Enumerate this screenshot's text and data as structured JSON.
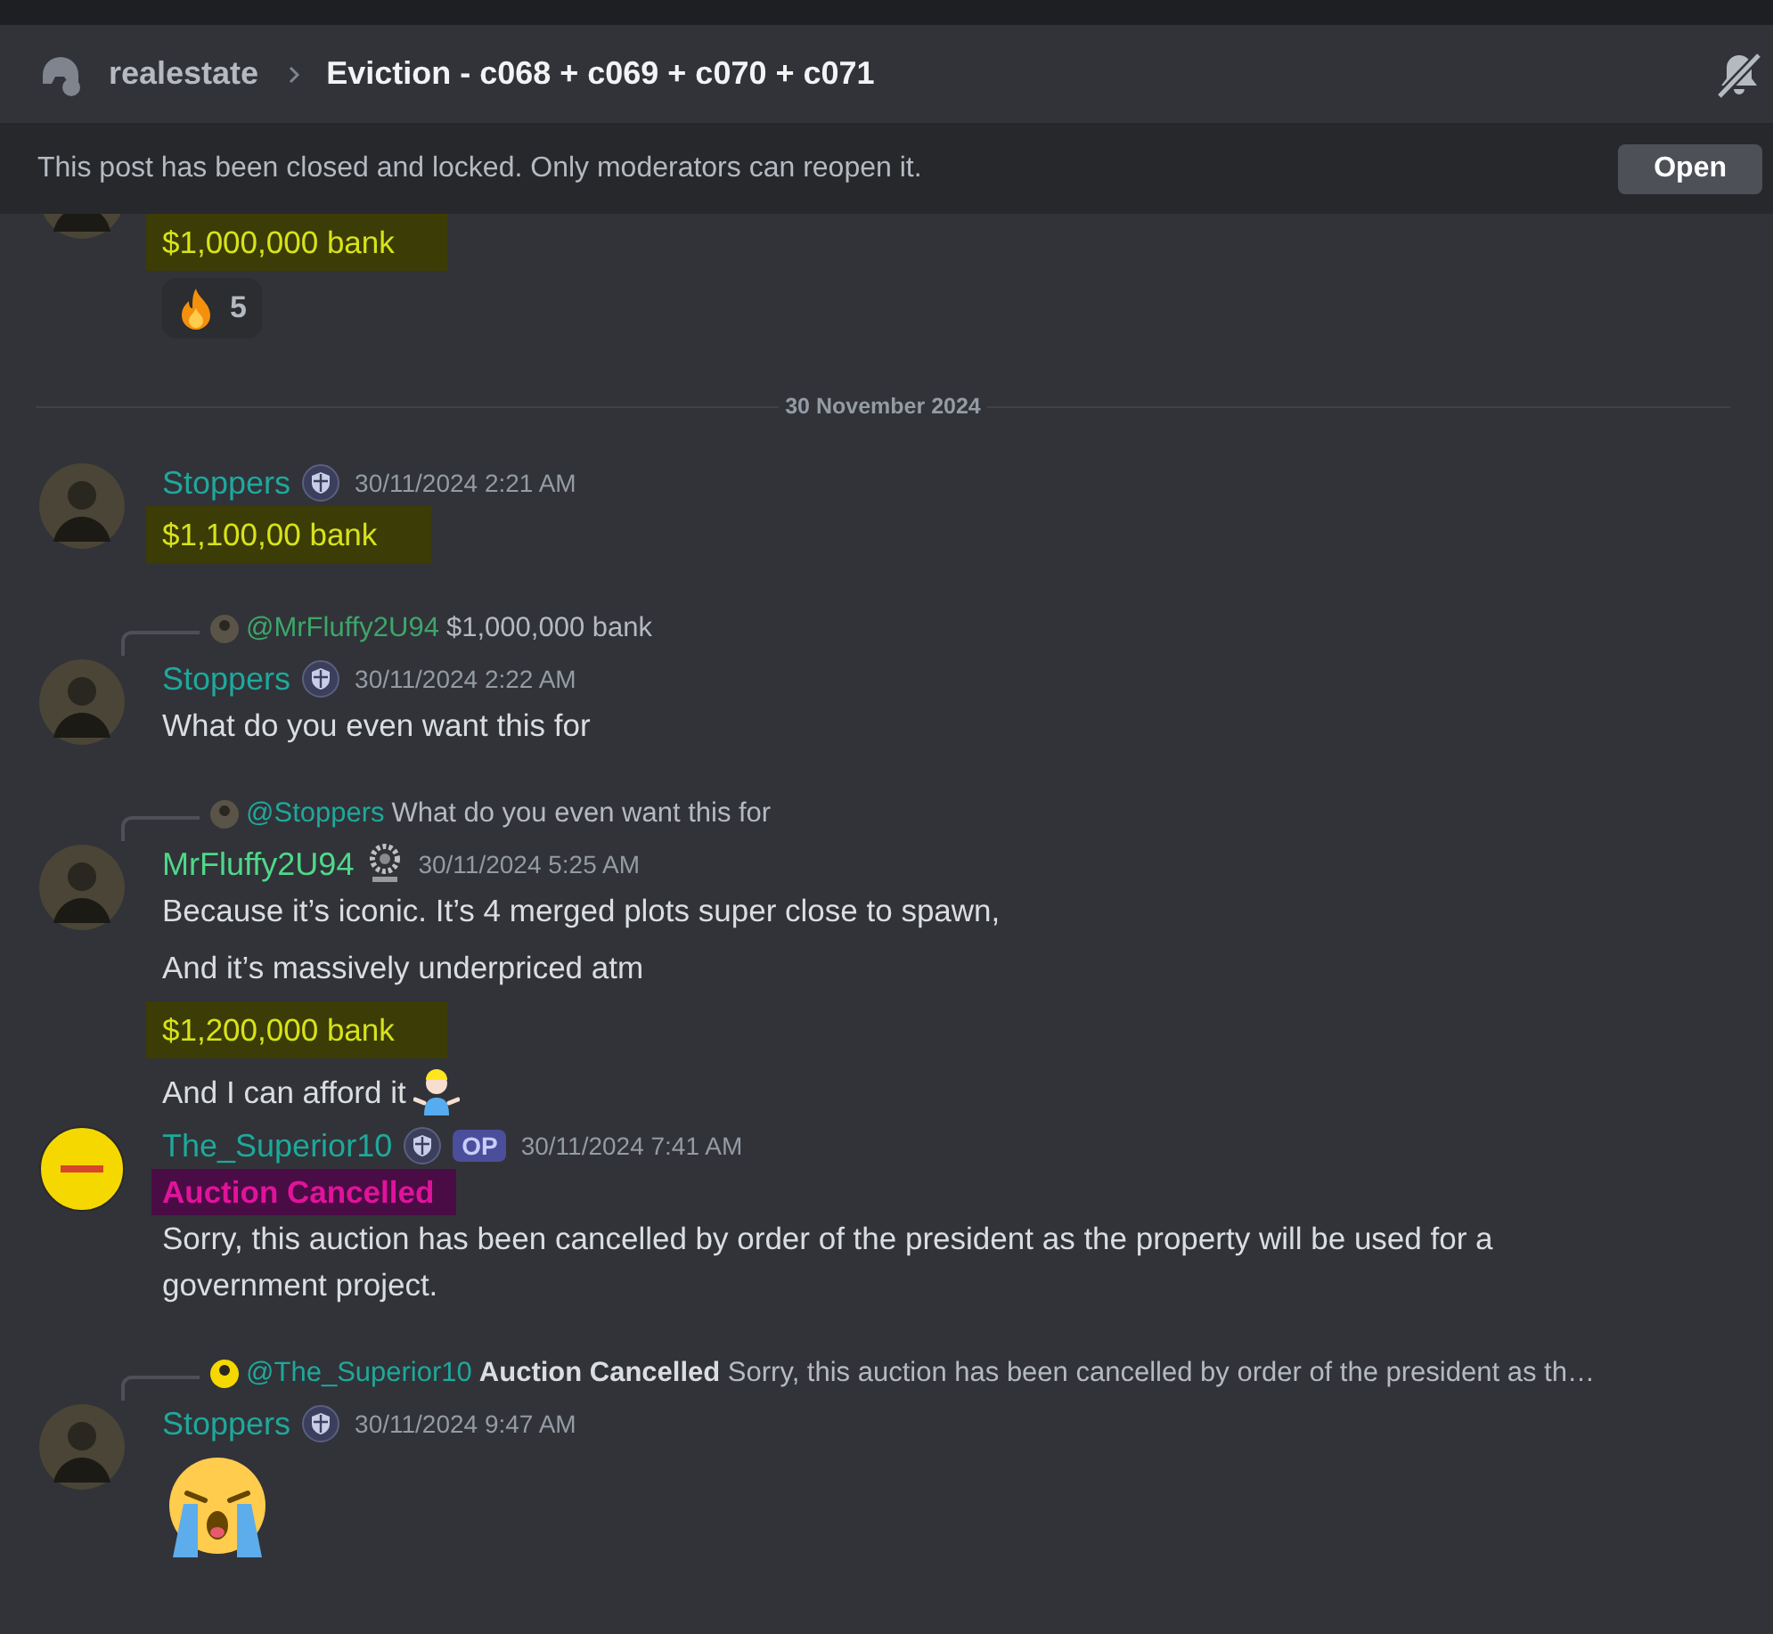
{
  "header": {
    "channel": "realestate",
    "thread": "Eviction - c068 + c069 + c070 + c071"
  },
  "banner": {
    "text": "This post has been closed and locked. Only moderators can reopen it.",
    "button": "Open"
  },
  "top_message": {
    "lines": [
      {
        "kind": "highlight",
        "text": "$1,000,000 bank"
      }
    ],
    "reactions": [
      {
        "kind": "fire",
        "count": "5"
      }
    ]
  },
  "divider": "30 November 2024",
  "messages": [
    {
      "author": "Stoppers",
      "color": "#1fa89c",
      "badge": {
        "kind": "shield"
      },
      "op": false,
      "timestamp": "30/11/2024 2:21 AM",
      "lines": [
        {
          "kind": "highlight",
          "text": "$1,100,00 bank"
        }
      ]
    },
    {
      "reply": {
        "mention": "@MrFluffy2U94",
        "color": "#3ea66b",
        "text": "$1,000,000 bank"
      },
      "author": "Stoppers",
      "color": "#1fa89c",
      "badge": {
        "kind": "shield"
      },
      "op": false,
      "timestamp": "30/11/2024 2:22 AM",
      "lines": [
        {
          "kind": "text",
          "text": "What do you even want this for"
        }
      ]
    },
    {
      "reply": {
        "mention": "@Stoppers",
        "color": "#1fa89c",
        "text": "What do you even want this for"
      },
      "author": "MrFluffy2U94",
      "color": "#4fd88a",
      "badge": {
        "kind": "wreath"
      },
      "op": false,
      "timestamp": "30/11/2024 5:25 AM",
      "lines": [
        {
          "kind": "text",
          "text": "Because it’s iconic. It’s 4 merged plots super close to spawn,"
        },
        {
          "kind": "text",
          "text": "And it’s massively underpriced atm"
        },
        {
          "kind": "highlight",
          "text": "$1,200,000 bank"
        },
        {
          "kind": "text",
          "text": "And I can afford it",
          "trailing_emoji": {
            "kind": "shrug"
          }
        }
      ]
    },
    {
      "author": "The_Superior10",
      "color": "#1fa89c",
      "badge": {
        "kind": "shield"
      },
      "op": true,
      "op_label": "OP",
      "timestamp": "30/11/2024 7:41 AM",
      "lines": [
        {
          "kind": "heading",
          "text": "Auction Cancelled"
        },
        {
          "kind": "text",
          "text": "Sorry, this auction has been cancelled by order of the president as the property will be used for a government project."
        }
      ]
    },
    {
      "reply": {
        "mention": "@The_Superior10",
        "color": "#1fa89c",
        "text": "**Auction Cancelled** Sorry, this auction has been cancelled by order of the president as th…"
      },
      "author": "Stoppers",
      "color": "#1fa89c",
      "badge": {
        "kind": "shield"
      },
      "op": false,
      "timestamp": "30/11/2024 9:47 AM",
      "lines": [
        {
          "kind": "emoji",
          "emoji": {
            "kind": "crying"
          }
        }
      ]
    }
  ]
}
